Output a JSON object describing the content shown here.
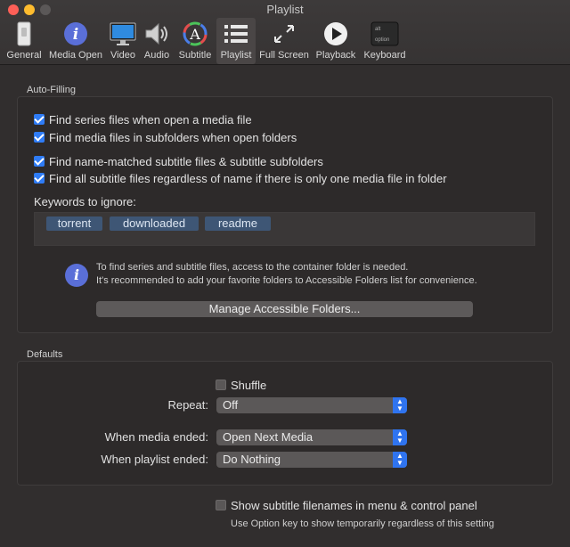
{
  "window": {
    "title": "Playlist"
  },
  "toolbar": {
    "items": [
      {
        "label": "General",
        "icon": "general-switch-icon"
      },
      {
        "label": "Media Open",
        "icon": "info-circle-icon"
      },
      {
        "label": "Video",
        "icon": "monitor-icon"
      },
      {
        "label": "Audio",
        "icon": "speaker-icon"
      },
      {
        "label": "Subtitle",
        "icon": "color-wheel-a-icon"
      },
      {
        "label": "Playlist",
        "icon": "list-icon",
        "active": true
      },
      {
        "label": "Full Screen",
        "icon": "expand-arrows-icon"
      },
      {
        "label": "Playback",
        "icon": "play-circle-icon"
      },
      {
        "label": "Keyboard",
        "icon": "option-key-icon"
      }
    ],
    "keycap_top": "alt",
    "keycap_bottom": "option"
  },
  "auto_filling": {
    "title": "Auto-Filling",
    "checks": [
      {
        "label": "Find series files when open a media file",
        "checked": true
      },
      {
        "label": "Find media files in subfolders when open folders",
        "checked": true
      },
      {
        "label": "Find name-matched subtitle files & subtitle subfolders",
        "checked": true
      },
      {
        "label": "Find all subtitle files regardless of name if there is only one media file in folder",
        "checked": true
      }
    ],
    "keywords_label": "Keywords to ignore:",
    "keywords": [
      "torrent",
      "downloaded",
      "readme"
    ],
    "info_line1": "To find series and subtitle files, access to the container folder is needed.",
    "info_line2": "It's recommended to add your favorite folders to Accessible Folders list for convenience.",
    "manage_button": "Manage Accessible Folders..."
  },
  "defaults": {
    "title": "Defaults",
    "shuffle_label": "Shuffle",
    "shuffle_checked": false,
    "repeat_label": "Repeat:",
    "repeat_value": "Off",
    "media_ended_label": "When media ended:",
    "media_ended_value": "Open Next Media",
    "playlist_ended_label": "When playlist ended:",
    "playlist_ended_value": "Do Nothing"
  },
  "footer": {
    "show_subtitle_label": "Show subtitle filenames in menu & control panel",
    "show_subtitle_checked": false,
    "hint": "Use Option key to show temporarily regardless of this setting"
  },
  "colors": {
    "accent": "#2f7cf6",
    "background": "#312e2e",
    "token": "#3e5675"
  }
}
